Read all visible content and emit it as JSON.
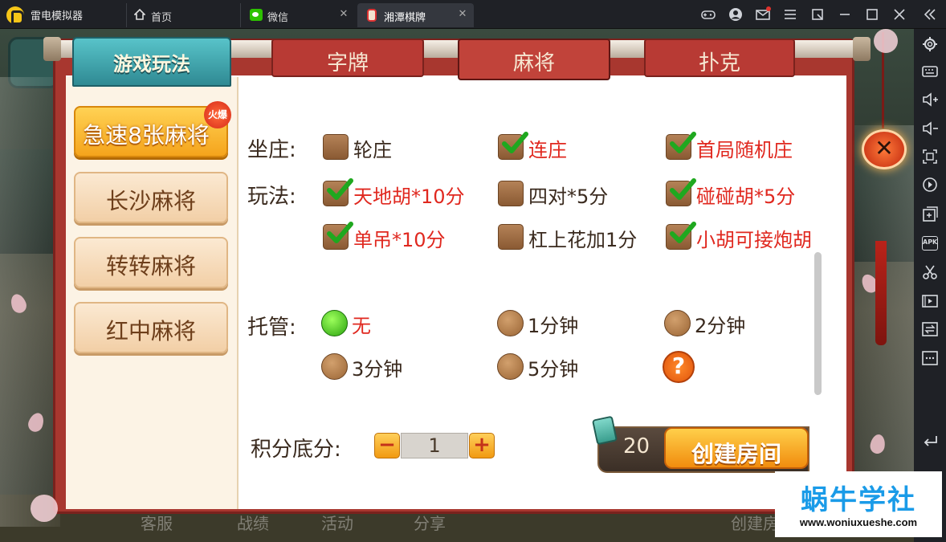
{
  "titlebar": {
    "app_name": "雷电模拟器",
    "tabs": [
      {
        "label": "首页",
        "icon": "home-icon"
      },
      {
        "label": "微信",
        "icon": "wechat-icon"
      },
      {
        "label": "湘潭棋牌",
        "icon": "game-icon",
        "active": true
      }
    ],
    "close_glyph": "✕",
    "controls_glyphs": {
      "gamepad": "🎮",
      "account": "●",
      "mail": "✉",
      "menu": "≡",
      "pin": "⧉",
      "minimize": "—",
      "maximize": "☐",
      "close": "✕",
      "collapse": "«"
    }
  },
  "sidebar": {
    "icons": [
      "settings-icon",
      "keyboard-icon",
      "volume-up-icon",
      "volume-down-icon",
      "fullscreen-icon",
      "rotate-icon",
      "add-window-icon",
      "apk-icon",
      "scissors-icon",
      "video-icon",
      "sync-icon",
      "more-icon",
      "back-icon"
    ],
    "apk_label": "APK"
  },
  "game": {
    "header": "游戏玩法",
    "categories": [
      {
        "label": "字牌",
        "active": false
      },
      {
        "label": "麻将",
        "active": true
      },
      {
        "label": "扑克",
        "active": false
      }
    ],
    "side_items": [
      {
        "label": "急速8张麻将",
        "active": true,
        "badge": "火爆"
      },
      {
        "label": "长沙麻将",
        "active": false
      },
      {
        "label": "转转麻将",
        "active": false
      },
      {
        "label": "红中麻将",
        "active": false
      }
    ],
    "banker": {
      "label": "坐庄:",
      "options": [
        {
          "text": "轮庄",
          "checked": false
        },
        {
          "text": "连庄",
          "checked": true
        },
        {
          "text": "首局随机庄",
          "checked": true
        }
      ]
    },
    "rules": {
      "label": "玩法:",
      "options": [
        {
          "text": "天地胡*10分",
          "checked": true
        },
        {
          "text": "四对*5分",
          "checked": false
        },
        {
          "text": "碰碰胡*5分",
          "checked": true
        },
        {
          "text": "单吊*10分",
          "checked": true
        },
        {
          "text": "杠上花加1分",
          "checked": false
        },
        {
          "text": "小胡可接炮胡",
          "checked": true
        }
      ]
    },
    "auto_play": {
      "label": "托管:",
      "options": [
        {
          "text": "无",
          "selected": true
        },
        {
          "text": "1分钟",
          "selected": false
        },
        {
          "text": "2分钟",
          "selected": false
        },
        {
          "text": "3分钟",
          "selected": false
        },
        {
          "text": "5分钟",
          "selected": false
        }
      ],
      "help": "?"
    },
    "score": {
      "label": "积分底分:",
      "value": "1",
      "minus": "−",
      "plus": "+"
    },
    "cost": "20",
    "create_label": "创建房间",
    "close_glyph": "✕",
    "bottom_bar": [
      "客服",
      "战绩",
      "活动",
      "分享",
      "创建房"
    ]
  },
  "watermark": {
    "title": "蜗牛学社",
    "url": "www.woniuxueshe.com"
  }
}
